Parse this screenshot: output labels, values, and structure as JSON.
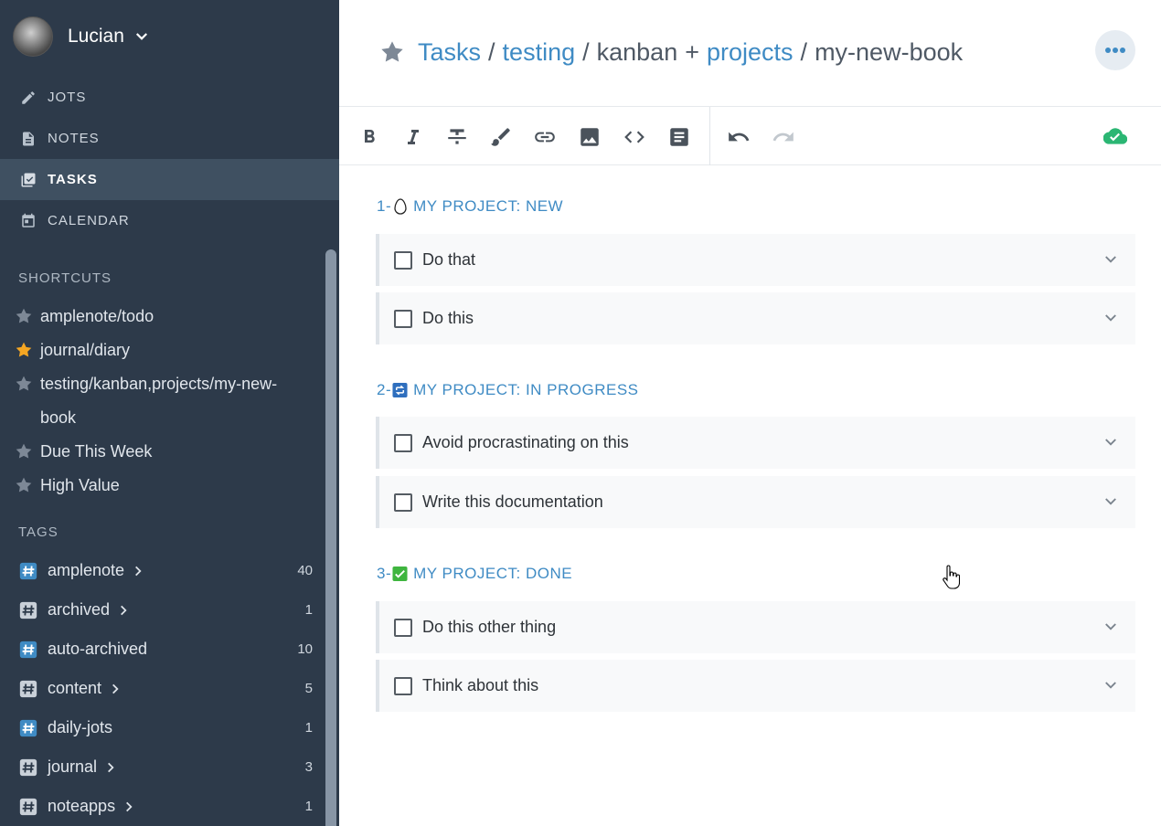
{
  "user": {
    "name": "Lucian"
  },
  "nav": [
    {
      "label": "JOTS",
      "icon": "pencil-icon"
    },
    {
      "label": "NOTES",
      "icon": "note-icon"
    },
    {
      "label": "TASKS",
      "icon": "tasks-icon",
      "active": true
    },
    {
      "label": "CALENDAR",
      "icon": "calendar-icon"
    }
  ],
  "shortcuts": {
    "title": "SHORTCUTS",
    "items": [
      {
        "label": "amplenote/todo",
        "starred": false
      },
      {
        "label": "journal/diary",
        "starred": true
      },
      {
        "label": "testing/kanban,projects/my-new-book",
        "line1": "testing/kanban,projects/my-new-",
        "line2": "book",
        "starred": false
      },
      {
        "label": "Due This Week",
        "starred": false
      },
      {
        "label": "High Value",
        "starred": false
      }
    ]
  },
  "tags": {
    "title": "TAGS",
    "items": [
      {
        "label": "amplenote",
        "count": "40",
        "expandable": true,
        "color": "blue"
      },
      {
        "label": "archived",
        "count": "1",
        "expandable": true,
        "color": "white"
      },
      {
        "label": "auto-archived",
        "count": "10",
        "expandable": false,
        "color": "blue"
      },
      {
        "label": "content",
        "count": "5",
        "expandable": true,
        "color": "white"
      },
      {
        "label": "daily-jots",
        "count": "1",
        "expandable": false,
        "color": "blue"
      },
      {
        "label": "journal",
        "count": "3",
        "expandable": true,
        "color": "white"
      },
      {
        "label": "noteapps",
        "count": "1",
        "expandable": true,
        "color": "white"
      }
    ]
  },
  "breadcrumb": {
    "tasks": "Tasks",
    "sep1": "/",
    "tag1": "testing",
    "sep2": "/",
    "tag2": "kanban",
    "plus": "+",
    "tag3": "projects",
    "sep3": "/",
    "tag4": "my-new-book"
  },
  "groups": [
    {
      "num": "1-",
      "title": "MY PROJECT: NEW",
      "emoji": "egg-icon",
      "tasks": [
        "Do that",
        "Do this"
      ]
    },
    {
      "num": "2-",
      "title": "MY PROJECT: IN PROGRESS",
      "emoji": "repeat-button-icon",
      "tasks": [
        "Avoid procrastinating on this",
        "Write this documentation"
      ]
    },
    {
      "num": "3-",
      "title": "MY PROJECT: DONE",
      "emoji": "check-mark-button-icon",
      "tasks": [
        "Do this other thing",
        "Think about this"
      ]
    }
  ],
  "colors": {
    "sidebar_bg": "#2d3a4a",
    "accent_link": "#3f8bc4",
    "sync_green": "#2bb673",
    "star_gold": "#f5a623"
  }
}
